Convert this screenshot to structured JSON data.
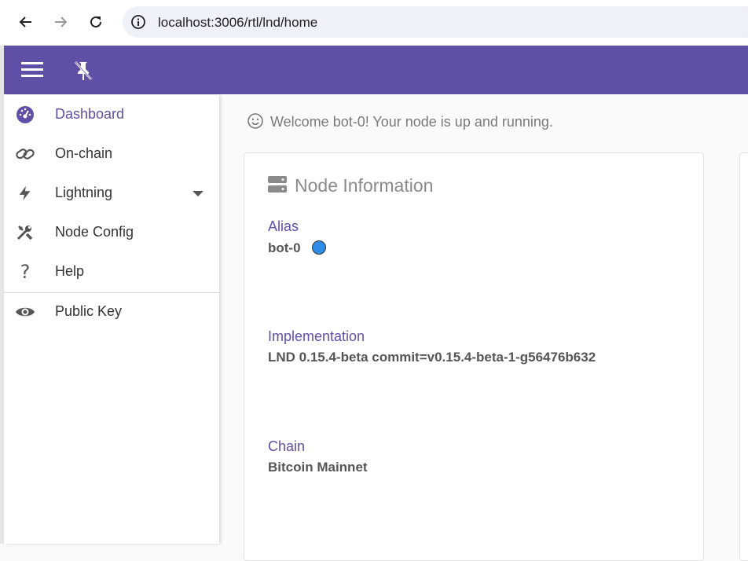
{
  "browser": {
    "url": "localhost:3006/rtl/lnd/home",
    "icons": [
      "back-arrow-icon",
      "forward-arrow-icon",
      "reload-icon",
      "site-info-icon"
    ]
  },
  "header": {
    "icons": [
      "menu-icon",
      "unpin-icon"
    ],
    "color": "#5f4fa6"
  },
  "sidebar": {
    "items": [
      {
        "label": "Dashboard",
        "icon": "dashboard-gauge-icon"
      },
      {
        "label": "On-chain",
        "icon": "link-icon"
      },
      {
        "label": "Lightning",
        "icon": "bolt-icon"
      },
      {
        "label": "Node Config",
        "icon": "tools-icon"
      },
      {
        "label": "Help",
        "icon": "question-icon"
      },
      {
        "label": "Public Key",
        "icon": "eye-icon"
      }
    ],
    "active_index": 0
  },
  "main": {
    "welcome": "Welcome bot-0! Your node is up and running.",
    "card": {
      "title": "Node Information",
      "fields": [
        {
          "label": "Alias",
          "value": "bot-0",
          "status_color": "#2f8de8"
        },
        {
          "label": "Implementation",
          "value": "LND 0.15.4-beta commit=v0.15.4-beta-1-g56476b632"
        },
        {
          "label": "Chain",
          "value": "Bitcoin Mainnet"
        }
      ]
    }
  },
  "colors": {
    "accent": "#5f4fa6",
    "status_blue": "#2f8de8"
  }
}
